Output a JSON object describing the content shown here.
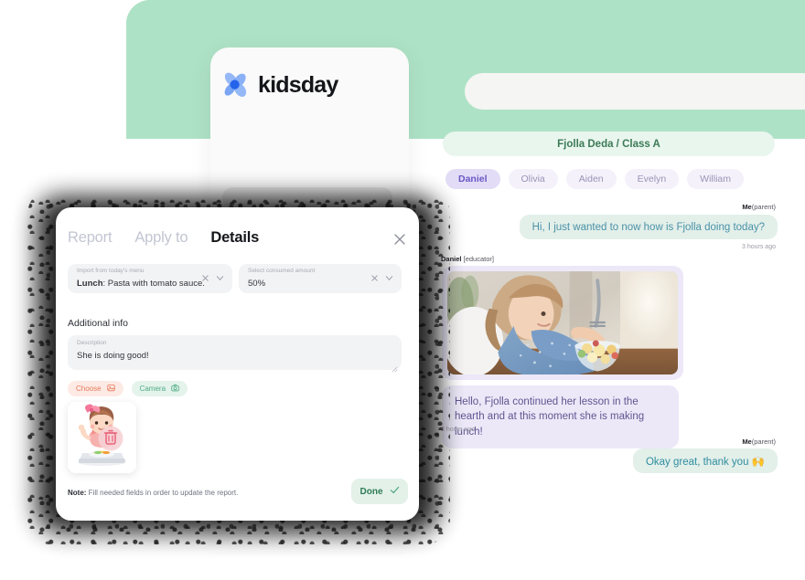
{
  "brand": {
    "name": "kidsday",
    "logo_icon": "pinwheel-logo-icon",
    "colors": {
      "petal_light": "#7da7f5",
      "petal_mid": "#5f8ef0",
      "petal_core": "#2563eb",
      "mint": "#aee2c6"
    }
  },
  "sidebar": {
    "skeleton_items": [
      "",
      ""
    ]
  },
  "chat": {
    "search": {
      "value": "",
      "placeholder": ""
    },
    "class_banner": "Fjolla Deda / Class A",
    "kids": [
      {
        "name": "Daniel",
        "active": true
      },
      {
        "name": "Olivia",
        "active": false
      },
      {
        "name": "Aiden",
        "active": false
      },
      {
        "name": "Evelyn",
        "active": false
      },
      {
        "name": "William",
        "active": false
      }
    ],
    "messages": [
      {
        "sender": "Me",
        "role": "(parent)",
        "side": "right",
        "type": "text",
        "text": "Hi, I just wanted to now how is Fjolla doing today?",
        "time": "3 hours ago"
      },
      {
        "sender": "Daniel",
        "role": "[educator]",
        "side": "left",
        "type": "image",
        "image_alt": "girl-eating-fruit-bowl-photo",
        "time": ""
      },
      {
        "sender": "",
        "role": "",
        "side": "left",
        "type": "text",
        "text": "Hello, Fjolla continued her lesson in the hearth and at this moment she is making lunch!",
        "time": "2 hours ago"
      },
      {
        "sender": "Me",
        "role": "(parent)",
        "side": "right",
        "type": "text",
        "text": "Okay great, thank you 🙌",
        "time": ""
      }
    ]
  },
  "modal": {
    "tabs": [
      {
        "label": "Report",
        "active": false
      },
      {
        "label": "Apply to",
        "active": false
      },
      {
        "label": "Details",
        "active": true
      }
    ],
    "close_icon": "close-icon",
    "fields": [
      {
        "label": "Import from today's menu",
        "value_prefix": "Lunch",
        "value": ": Pasta with tomato sauce.",
        "clear_icon": "clear-icon",
        "chevron_icon": "chevron-down-icon"
      },
      {
        "label": "Select consumed amount",
        "value_prefix": "",
        "value": "50%",
        "clear_icon": "clear-icon",
        "chevron_icon": "chevron-down-icon"
      }
    ],
    "section_title": "Additional info",
    "description": {
      "label": "Description",
      "value": "She is doing good!"
    },
    "attachment_buttons": [
      {
        "label": "Choose",
        "icon": "image-icon"
      },
      {
        "label": "Camera",
        "icon": "camera-icon"
      }
    ],
    "thumbnail": {
      "alt": "girl-eating-illustration",
      "delete_icon": "trash-icon"
    },
    "note_prefix": "Note:",
    "note_text": " Fill needed fields in order to update the report.",
    "done_label": "Done",
    "done_icon": "check-icon"
  }
}
